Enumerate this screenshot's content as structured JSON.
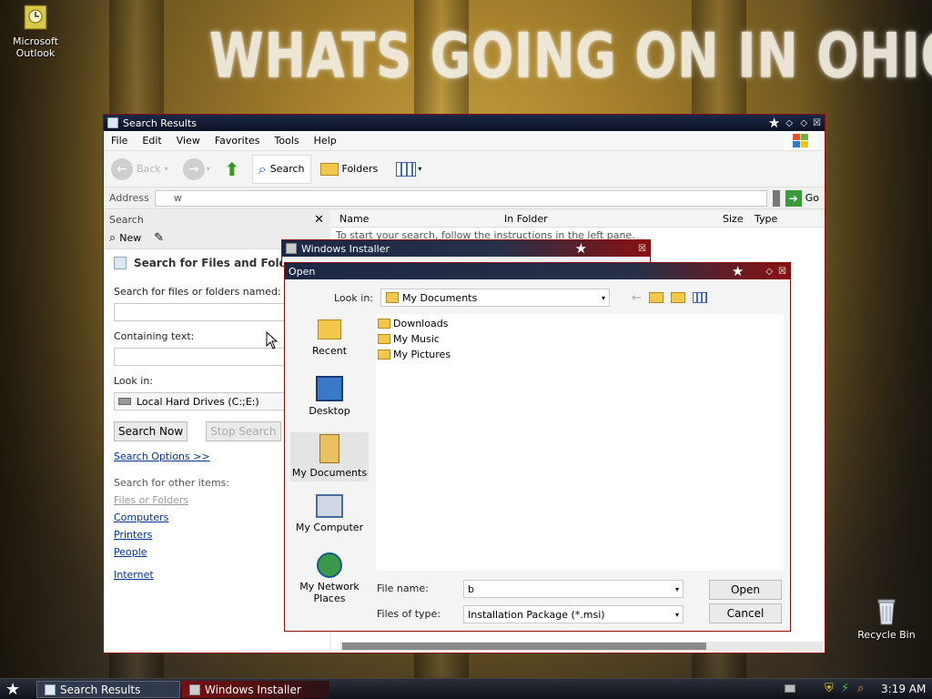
{
  "desktop": {
    "meme_text": "WHATS GOING ON IN OHIO",
    "icons": [
      {
        "label": "Microsoft\nOutlook",
        "icon": "outlook-icon"
      },
      {
        "label": "Recycle Bin",
        "icon": "recycle-bin-icon"
      }
    ]
  },
  "search_window": {
    "title": "Search Results",
    "menu": [
      "File",
      "Edit",
      "View",
      "Favorites",
      "Tools",
      "Help"
    ],
    "toolbar": {
      "back": "Back",
      "search": "Search",
      "folders": "Folders"
    },
    "address": {
      "label": "Address",
      "value": "w",
      "go": "Go"
    },
    "pane": {
      "title": "Search",
      "new_label": "New",
      "heading": "Search for Files and Folders",
      "named_label": "Search for files or folders named:",
      "named_value": "",
      "containing_label": "Containing text:",
      "containing_value": "",
      "lookin_label": "Look in:",
      "lookin_value": "Local Hard Drives (C:;E:)",
      "search_now": "Search Now",
      "stop_search": "Stop Search",
      "options": "Search Options >>",
      "other_label": "Search for other items:",
      "other_items": [
        "Files or Folders",
        "Computers",
        "Printers",
        "People"
      ],
      "internet": "Internet"
    },
    "columns": [
      "Name",
      "In Folder",
      "Size",
      "Type"
    ],
    "empty_message": "To start your search, follow the instructions in the left pane."
  },
  "installer_window": {
    "title": "Windows Installer"
  },
  "open_dialog": {
    "title": "Open",
    "lookin_label": "Look in:",
    "lookin_value": "My Documents",
    "places": [
      "Recent",
      "Desktop",
      "My Documents",
      "My Computer",
      "My Network Places"
    ],
    "files": [
      "Downloads",
      "My Music",
      "My Pictures"
    ],
    "filename_label": "File name:",
    "filename_value": "b",
    "filetype_label": "Files of type:",
    "filetype_value": "Installation Package (*.msi)",
    "open_btn": "Open",
    "cancel_btn": "Cancel"
  },
  "taskbar": {
    "buttons": [
      "Search Results",
      "Windows Installer"
    ],
    "time": "3:19 AM"
  },
  "colors": {
    "titlebar": "#0f1a33",
    "accent_red": "#a01818",
    "link": "#003399",
    "taskbar": "#1a1e26"
  }
}
